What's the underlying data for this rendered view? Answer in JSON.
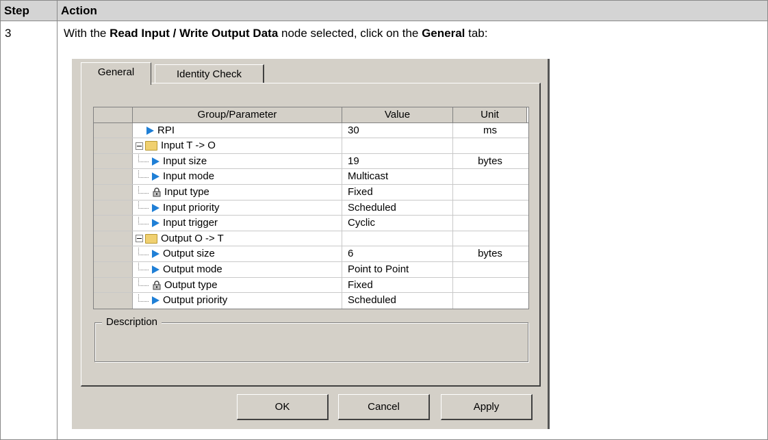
{
  "table": {
    "header_step": "Step",
    "header_action": "Action",
    "step_number": "3",
    "instruction": {
      "part1": "With the ",
      "bold1": "Read Input / Write Output Data",
      "part2": " node selected, click on the ",
      "bold2": "General",
      "part3": " tab:"
    }
  },
  "dialog": {
    "tabs": [
      "General",
      "Identity Check"
    ],
    "active_tab": "General",
    "grid": {
      "columns": [
        "Group/Parameter",
        "Value",
        "Unit"
      ],
      "rows": [
        {
          "icon": "blue-triangle",
          "indent": 1,
          "name": "RPI",
          "value": "30",
          "unit": "ms"
        },
        {
          "icon": "folder",
          "indent": 0,
          "expander": "minus",
          "name": "Input T -> O",
          "value": "",
          "unit": ""
        },
        {
          "icon": "blue-triangle",
          "indent": 2,
          "name": "Input size",
          "value": "19",
          "unit": "bytes"
        },
        {
          "icon": "blue-triangle",
          "indent": 2,
          "name": "Input mode",
          "value": "Multicast",
          "unit": ""
        },
        {
          "icon": "lock",
          "indent": 2,
          "name": "Input type",
          "value": "Fixed",
          "unit": ""
        },
        {
          "icon": "blue-triangle",
          "indent": 2,
          "name": "Input priority",
          "value": "Scheduled",
          "unit": ""
        },
        {
          "icon": "blue-triangle",
          "indent": 2,
          "name": "Input trigger",
          "value": "Cyclic",
          "unit": ""
        },
        {
          "icon": "folder",
          "indent": 0,
          "expander": "minus",
          "name": "Output O -> T",
          "value": "",
          "unit": ""
        },
        {
          "icon": "blue-triangle",
          "indent": 2,
          "name": "Output size",
          "value": "6",
          "unit": "bytes"
        },
        {
          "icon": "blue-triangle",
          "indent": 2,
          "name": "Output mode",
          "value": "Point to Point",
          "unit": ""
        },
        {
          "icon": "lock",
          "indent": 2,
          "name": "Output type",
          "value": "Fixed",
          "unit": ""
        },
        {
          "icon": "blue-triangle",
          "indent": 2,
          "name": "Output priority",
          "value": "Scheduled",
          "unit": ""
        }
      ]
    },
    "description_label": "Description",
    "buttons": {
      "ok": "OK",
      "cancel": "Cancel",
      "apply": "Apply"
    }
  },
  "colors": {
    "header_bg": "#d4d4d4",
    "dialog_bg": "#d4d0c8",
    "param_icon": "#1f7fd6",
    "folder": "#f0d070"
  }
}
